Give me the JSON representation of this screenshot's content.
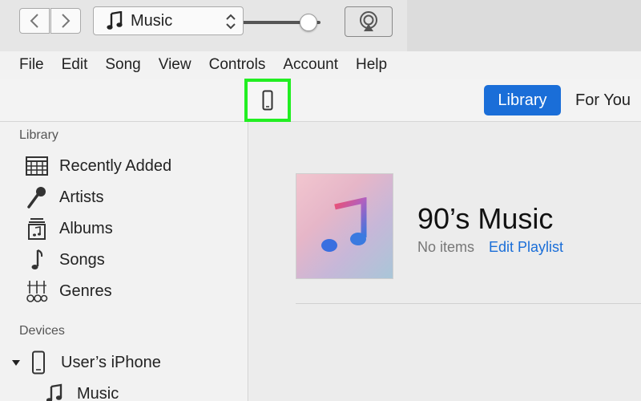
{
  "menu": [
    "File",
    "Edit",
    "Song",
    "View",
    "Controls",
    "Account",
    "Help"
  ],
  "toolbar": {
    "media_label": "Music",
    "tabs": {
      "library": "Library",
      "for_you": "For You"
    }
  },
  "sidebar": {
    "library_heading": "Library",
    "library_items": [
      {
        "label": "Recently Added",
        "icon": "grid-icon"
      },
      {
        "label": "Artists",
        "icon": "microphone-icon"
      },
      {
        "label": "Albums",
        "icon": "album-icon"
      },
      {
        "label": "Songs",
        "icon": "music-note-icon"
      },
      {
        "label": "Genres",
        "icon": "guitar-icon"
      }
    ],
    "devices_heading": "Devices",
    "device_name": "User’s iPhone",
    "device_sub_item": "Music"
  },
  "playlist": {
    "title": "90’s Music",
    "status": "No items",
    "edit_link": "Edit Playlist"
  },
  "colors": {
    "accent": "#1a6ed8",
    "highlight": "#22ee22"
  },
  "player": {
    "volume_fraction": 0.9
  }
}
